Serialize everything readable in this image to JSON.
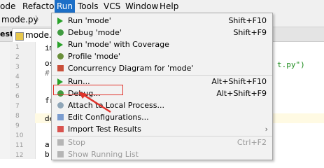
{
  "menubar": {
    "items": [
      "ode",
      "Refactor",
      "Run",
      "Tools",
      "VCS",
      "Window",
      "Help"
    ]
  },
  "pathbar": {
    "file": "mode.py",
    "chevron": "〉"
  },
  "tabs": {
    "left_label": "est",
    "file_tab": "mode.p"
  },
  "editor": {
    "line_numbers": [
      "1",
      "2",
      "3",
      "4",
      "5",
      "6",
      "7",
      "8",
      "9",
      "10",
      "11",
      "12"
    ],
    "code": {
      "im": "im",
      "os": "os",
      "hash": "#",
      "fr": "fr",
      "de": "de",
      "a": "a",
      "b": "b",
      "right_fragment": "t.py\")"
    }
  },
  "menu": {
    "items": [
      {
        "label": "Run 'mode'",
        "shortcut": "Shift+F10",
        "icon": "run-icon"
      },
      {
        "label": "Debug 'mode'",
        "shortcut": "Shift+F9",
        "icon": "debug-icon"
      },
      {
        "label": "Run 'mode' with Coverage",
        "shortcut": "",
        "icon": "coverage-icon"
      },
      {
        "label": "Profile 'mode'",
        "shortcut": "",
        "icon": "profile-icon"
      },
      {
        "label": "Concurrency Diagram for 'mode'",
        "shortcut": "",
        "icon": "concurrency-icon"
      },
      {
        "label": "Run...",
        "shortcut": "Alt+Shift+F10",
        "icon": "run-icon"
      },
      {
        "label": "Debug...",
        "shortcut": "Alt+Shift+F9",
        "icon": "debug-icon"
      },
      {
        "label": "Attach to Local Process...",
        "shortcut": "",
        "icon": "attach-icon"
      },
      {
        "label": "Edit Configurations...",
        "shortcut": "",
        "icon": "edit-config-icon"
      },
      {
        "label": "Import Test Results",
        "shortcut": "",
        "icon": "import-icon",
        "submenu": "›"
      },
      {
        "label": "Stop",
        "shortcut": "Ctrl+F2",
        "icon": "stop-icon",
        "disabled": true
      },
      {
        "label": "Show Running List",
        "shortcut": "",
        "icon": "list-icon",
        "disabled": true
      }
    ]
  },
  "colors": {
    "highlight": "#e0332b",
    "menu_active": "#1c6fc7"
  }
}
